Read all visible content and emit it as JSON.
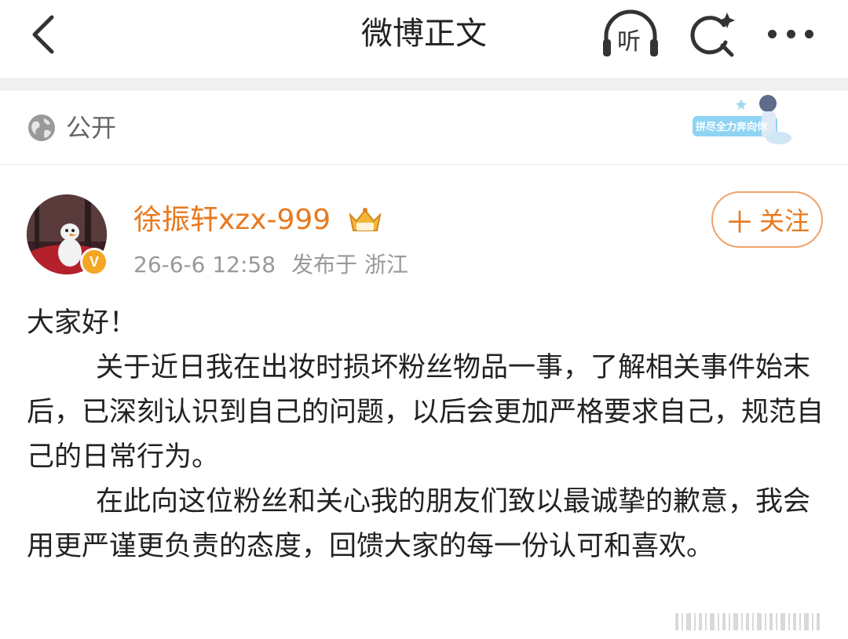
{
  "nav": {
    "title": "微博正文",
    "listen_label": "听"
  },
  "visibility": {
    "label": "公开",
    "badge_text": "拼尽全力奔向你"
  },
  "post": {
    "username": "徐振轩xzx-999",
    "timestamp": "26-6-6 12:58",
    "location": "发布于 浙江",
    "follow_label": "关注",
    "verified_mark": "V",
    "paragraphs": [
      "大家好！",
      "关于近日我在出妆时损坏粉丝物品一事，了解相关事件始末后，已深刻认识到自己的问题，以后会更加严格要求自己，规范自己的日常行为。",
      "在此向这位粉丝和关心我的朋友们致以最诚挚的歉意，我会用更严谨更负责的态度，回馈大家的每一份认可和喜欢。"
    ]
  },
  "colors": {
    "accent": "#e8791e",
    "meta_gray": "#999999",
    "verified": "#f5a623"
  },
  "icons": [
    "back-arrow-icon",
    "headphones-icon",
    "search-sparkle-icon",
    "more-icon",
    "globe-icon",
    "crown-badge-icon"
  ]
}
